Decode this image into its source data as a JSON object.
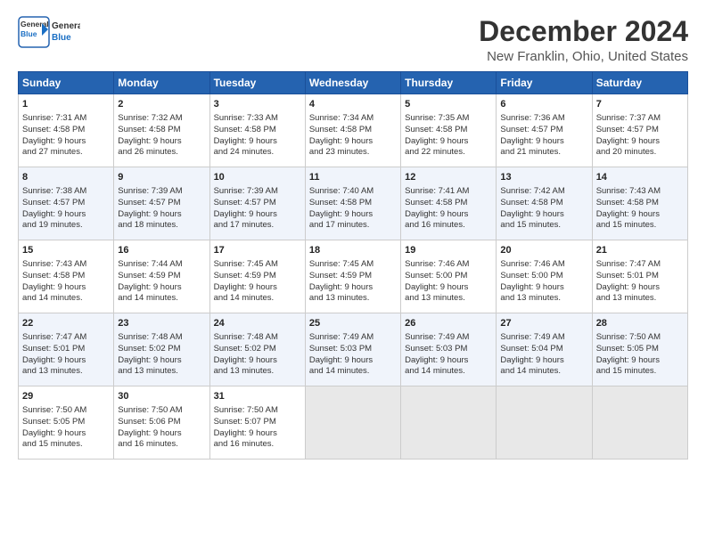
{
  "logo": {
    "line1": "General",
    "line2": "Blue"
  },
  "title": "December 2024",
  "location": "New Franklin, Ohio, United States",
  "days_header": [
    "Sunday",
    "Monday",
    "Tuesday",
    "Wednesday",
    "Thursday",
    "Friday",
    "Saturday"
  ],
  "weeks": [
    [
      {
        "day": "1",
        "lines": [
          "Sunrise: 7:31 AM",
          "Sunset: 4:58 PM",
          "Daylight: 9 hours",
          "and 27 minutes."
        ]
      },
      {
        "day": "2",
        "lines": [
          "Sunrise: 7:32 AM",
          "Sunset: 4:58 PM",
          "Daylight: 9 hours",
          "and 26 minutes."
        ]
      },
      {
        "day": "3",
        "lines": [
          "Sunrise: 7:33 AM",
          "Sunset: 4:58 PM",
          "Daylight: 9 hours",
          "and 24 minutes."
        ]
      },
      {
        "day": "4",
        "lines": [
          "Sunrise: 7:34 AM",
          "Sunset: 4:58 PM",
          "Daylight: 9 hours",
          "and 23 minutes."
        ]
      },
      {
        "day": "5",
        "lines": [
          "Sunrise: 7:35 AM",
          "Sunset: 4:58 PM",
          "Daylight: 9 hours",
          "and 22 minutes."
        ]
      },
      {
        "day": "6",
        "lines": [
          "Sunrise: 7:36 AM",
          "Sunset: 4:57 PM",
          "Daylight: 9 hours",
          "and 21 minutes."
        ]
      },
      {
        "day": "7",
        "lines": [
          "Sunrise: 7:37 AM",
          "Sunset: 4:57 PM",
          "Daylight: 9 hours",
          "and 20 minutes."
        ]
      }
    ],
    [
      {
        "day": "8",
        "lines": [
          "Sunrise: 7:38 AM",
          "Sunset: 4:57 PM",
          "Daylight: 9 hours",
          "and 19 minutes."
        ]
      },
      {
        "day": "9",
        "lines": [
          "Sunrise: 7:39 AM",
          "Sunset: 4:57 PM",
          "Daylight: 9 hours",
          "and 18 minutes."
        ]
      },
      {
        "day": "10",
        "lines": [
          "Sunrise: 7:39 AM",
          "Sunset: 4:57 PM",
          "Daylight: 9 hours",
          "and 17 minutes."
        ]
      },
      {
        "day": "11",
        "lines": [
          "Sunrise: 7:40 AM",
          "Sunset: 4:58 PM",
          "Daylight: 9 hours",
          "and 17 minutes."
        ]
      },
      {
        "day": "12",
        "lines": [
          "Sunrise: 7:41 AM",
          "Sunset: 4:58 PM",
          "Daylight: 9 hours",
          "and 16 minutes."
        ]
      },
      {
        "day": "13",
        "lines": [
          "Sunrise: 7:42 AM",
          "Sunset: 4:58 PM",
          "Daylight: 9 hours",
          "and 15 minutes."
        ]
      },
      {
        "day": "14",
        "lines": [
          "Sunrise: 7:43 AM",
          "Sunset: 4:58 PM",
          "Daylight: 9 hours",
          "and 15 minutes."
        ]
      }
    ],
    [
      {
        "day": "15",
        "lines": [
          "Sunrise: 7:43 AM",
          "Sunset: 4:58 PM",
          "Daylight: 9 hours",
          "and 14 minutes."
        ]
      },
      {
        "day": "16",
        "lines": [
          "Sunrise: 7:44 AM",
          "Sunset: 4:59 PM",
          "Daylight: 9 hours",
          "and 14 minutes."
        ]
      },
      {
        "day": "17",
        "lines": [
          "Sunrise: 7:45 AM",
          "Sunset: 4:59 PM",
          "Daylight: 9 hours",
          "and 14 minutes."
        ]
      },
      {
        "day": "18",
        "lines": [
          "Sunrise: 7:45 AM",
          "Sunset: 4:59 PM",
          "Daylight: 9 hours",
          "and 13 minutes."
        ]
      },
      {
        "day": "19",
        "lines": [
          "Sunrise: 7:46 AM",
          "Sunset: 5:00 PM",
          "Daylight: 9 hours",
          "and 13 minutes."
        ]
      },
      {
        "day": "20",
        "lines": [
          "Sunrise: 7:46 AM",
          "Sunset: 5:00 PM",
          "Daylight: 9 hours",
          "and 13 minutes."
        ]
      },
      {
        "day": "21",
        "lines": [
          "Sunrise: 7:47 AM",
          "Sunset: 5:01 PM",
          "Daylight: 9 hours",
          "and 13 minutes."
        ]
      }
    ],
    [
      {
        "day": "22",
        "lines": [
          "Sunrise: 7:47 AM",
          "Sunset: 5:01 PM",
          "Daylight: 9 hours",
          "and 13 minutes."
        ]
      },
      {
        "day": "23",
        "lines": [
          "Sunrise: 7:48 AM",
          "Sunset: 5:02 PM",
          "Daylight: 9 hours",
          "and 13 minutes."
        ]
      },
      {
        "day": "24",
        "lines": [
          "Sunrise: 7:48 AM",
          "Sunset: 5:02 PM",
          "Daylight: 9 hours",
          "and 13 minutes."
        ]
      },
      {
        "day": "25",
        "lines": [
          "Sunrise: 7:49 AM",
          "Sunset: 5:03 PM",
          "Daylight: 9 hours",
          "and 14 minutes."
        ]
      },
      {
        "day": "26",
        "lines": [
          "Sunrise: 7:49 AM",
          "Sunset: 5:03 PM",
          "Daylight: 9 hours",
          "and 14 minutes."
        ]
      },
      {
        "day": "27",
        "lines": [
          "Sunrise: 7:49 AM",
          "Sunset: 5:04 PM",
          "Daylight: 9 hours",
          "and 14 minutes."
        ]
      },
      {
        "day": "28",
        "lines": [
          "Sunrise: 7:50 AM",
          "Sunset: 5:05 PM",
          "Daylight: 9 hours",
          "and 15 minutes."
        ]
      }
    ],
    [
      {
        "day": "29",
        "lines": [
          "Sunrise: 7:50 AM",
          "Sunset: 5:05 PM",
          "Daylight: 9 hours",
          "and 15 minutes."
        ]
      },
      {
        "day": "30",
        "lines": [
          "Sunrise: 7:50 AM",
          "Sunset: 5:06 PM",
          "Daylight: 9 hours",
          "and 16 minutes."
        ]
      },
      {
        "day": "31",
        "lines": [
          "Sunrise: 7:50 AM",
          "Sunset: 5:07 PM",
          "Daylight: 9 hours",
          "and 16 minutes."
        ]
      },
      null,
      null,
      null,
      null
    ]
  ]
}
